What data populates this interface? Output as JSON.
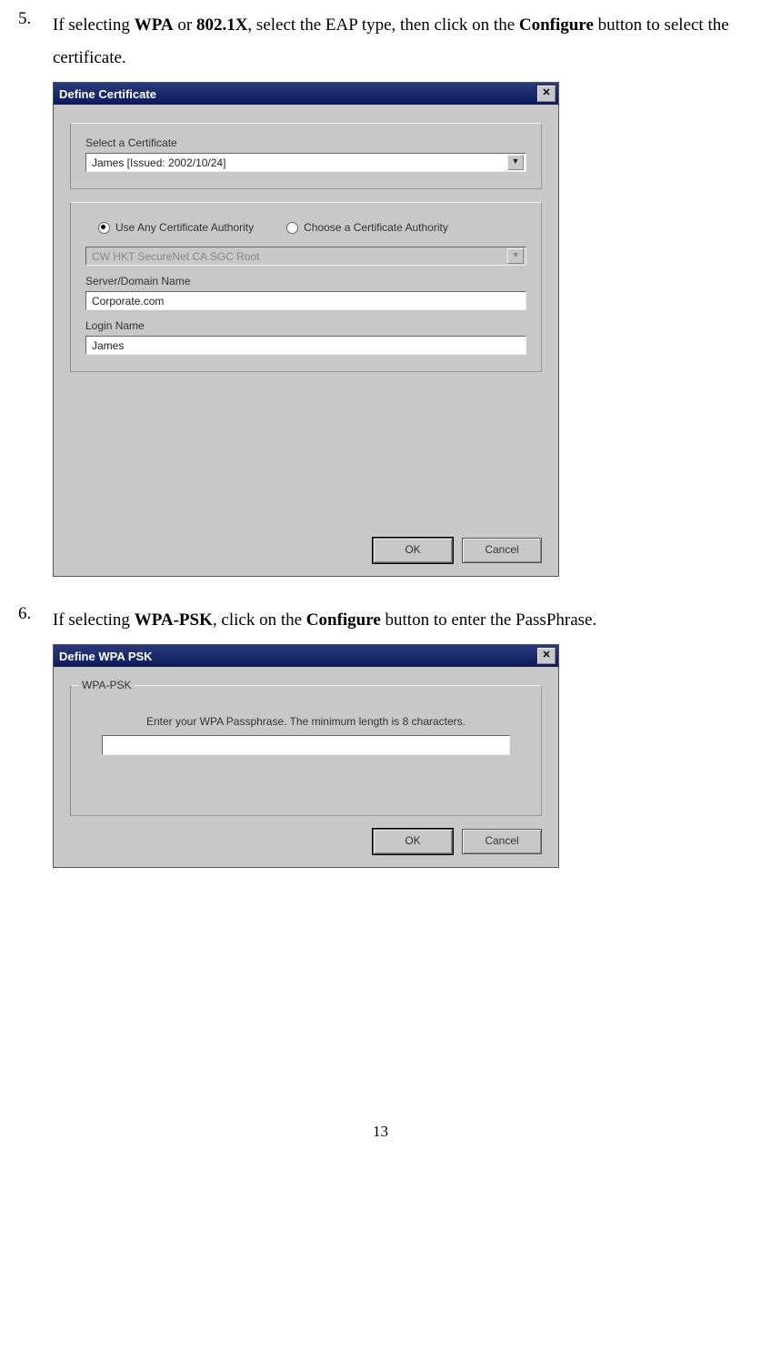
{
  "steps": {
    "s5": {
      "num": "5.",
      "pre": "If selecting ",
      "b1": "WPA",
      "mid1": " or ",
      "b2": "802.1X",
      "mid2": ", select the EAP type, then click on the ",
      "b3": "Configure",
      "post": " button to select the certificate."
    },
    "s6": {
      "num": "6.",
      "pre": "If selecting ",
      "b1": "WPA-PSK",
      "mid1": ", click on the ",
      "b2": "Configure",
      "post": " button to enter the PassPhrase."
    }
  },
  "dialog1": {
    "title": "Define Certificate",
    "close": "✕",
    "label_select_cert": "Select a Certificate",
    "cert_value": "James    [Issued: 2002/10/24]",
    "radio_use_any": "Use Any Certificate Authority",
    "radio_choose": "Choose a Certificate Authority",
    "ca_value": "CW HKT SecureNet CA SGC Root",
    "label_server": "Server/Domain Name",
    "server_value": "Corporate.com",
    "label_login": "Login Name",
    "login_value": "James",
    "ok": "OK",
    "cancel": "Cancel"
  },
  "dialog2": {
    "title": "Define WPA PSK",
    "close": "✕",
    "group_title": "WPA-PSK",
    "instruction": "Enter your WPA Passphrase.   The minimum length is 8 characters.",
    "ok": "OK",
    "cancel": "Cancel"
  },
  "page_number": "13"
}
